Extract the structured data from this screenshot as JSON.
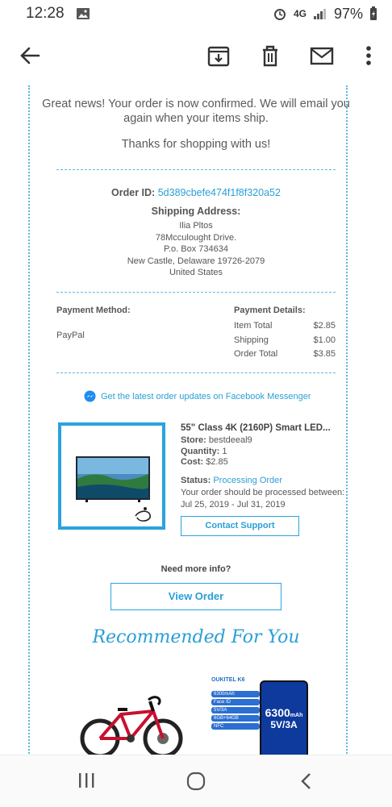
{
  "status_bar": {
    "time": "12:28",
    "network": "4G",
    "battery": "97%"
  },
  "email": {
    "confirm_text": "Great news! Your order is now confirmed. We will email you again when your items ship.",
    "thanks_text": "Thanks for shopping with us!",
    "order_id_label": "Order ID:",
    "order_id": "5d389cbefe474f1f8f320a52",
    "shipping_label": "Shipping Address:",
    "address": [
      "Ilia Pltos",
      "78Mcculought Drive.",
      "P.o. Box 734634",
      "New Castle, Delaware 19726-2079",
      "United States"
    ],
    "payment_method_label": "Payment Method:",
    "payment_method": "PayPal",
    "payment_details_label": "Payment Details:",
    "payment_details": [
      {
        "label": "Item Total",
        "value": "$2.85"
      },
      {
        "label": "Shipping",
        "value": "$1.00"
      },
      {
        "label": "Order Total",
        "value": "$3.85"
      }
    ],
    "messenger_link": "Get the latest order updates on Facebook Messenger",
    "product": {
      "title": "55\" Class 4K (2160P) Smart LED...",
      "store_label": "Store:",
      "store": "bestdeeal9",
      "quantity_label": "Quantity:",
      "quantity": "1",
      "cost_label": "Cost:",
      "cost": "$2.85",
      "status_label": "Status:",
      "status": "Processing Order",
      "process_text": "Your order should be processed between:",
      "dates": "Jul 25, 2019 - Jul 31, 2019"
    },
    "contact_support": "Contact Support",
    "need_info": "Need more info?",
    "view_order": "View Order",
    "recommended_title": "Recommended For You",
    "rec_phone": {
      "brand": "OUKITEL K6",
      "specs": [
        "6300mAh",
        "Face ID",
        "5V/3A",
        "6GB+64GB",
        "NFC"
      ],
      "big": "6300",
      "unit": "mAh",
      "charge": "5V/3A"
    }
  },
  "colors": {
    "accent": "#2aa3dd",
    "link": "#2a9fd6"
  }
}
